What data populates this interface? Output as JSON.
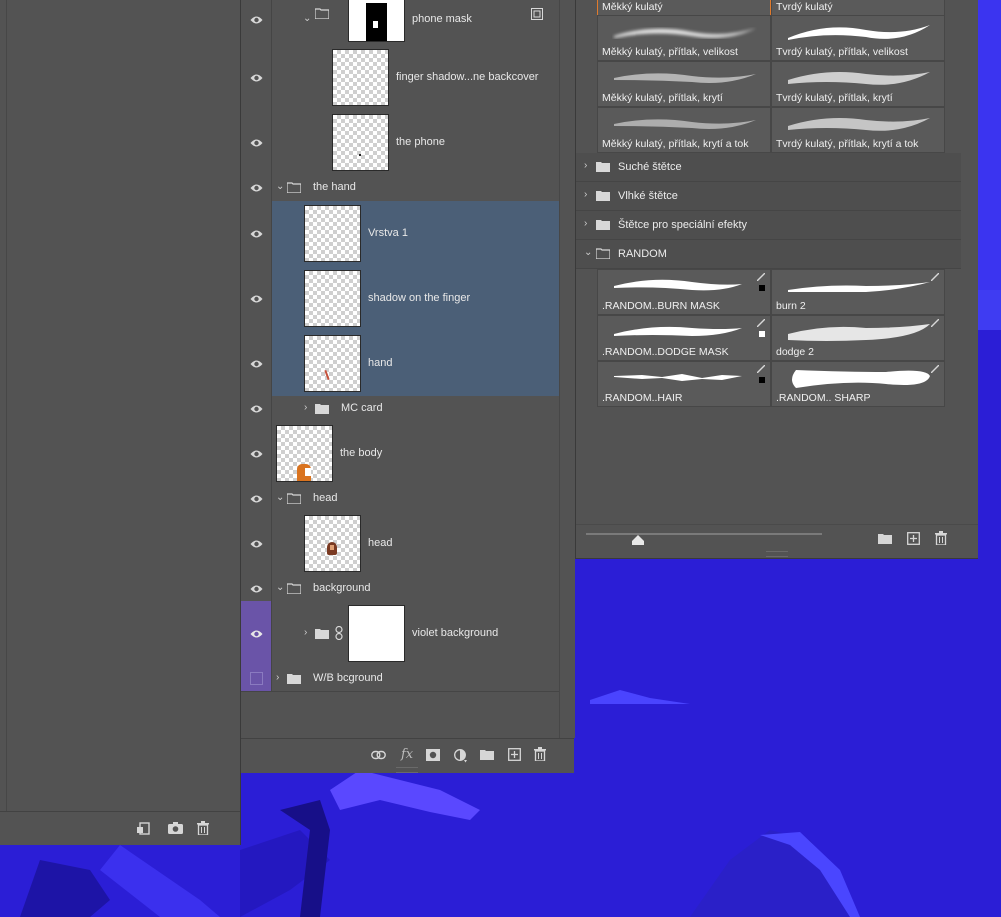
{
  "history_panel": {
    "footer_icons": [
      "new-document-from-state-icon",
      "snapshot-camera-icon",
      "trash-icon"
    ]
  },
  "layers": {
    "rows": [
      {
        "label": "phone mask",
        "type": "group-layer"
      },
      {
        "label": "finger shadow...ne backcover"
      },
      {
        "label": "the phone"
      },
      {
        "label": "the hand",
        "type": "group"
      },
      {
        "label": "Vrstva 1"
      },
      {
        "label": "shadow on the finger"
      },
      {
        "label": "hand"
      },
      {
        "label": "MC card",
        "type": "group"
      },
      {
        "label": "the body"
      },
      {
        "label": "head",
        "type": "group"
      },
      {
        "label": "head"
      },
      {
        "label": "background",
        "type": "group"
      },
      {
        "label": "violet background"
      },
      {
        "label": "W/B bcground",
        "type": "group"
      }
    ],
    "footer_icons": [
      "link-icon",
      "fx-icon",
      "mask-icon",
      "adjustment-icon",
      "folder-icon",
      "new-layer-icon",
      "trash-icon"
    ],
    "fx_label": "fx"
  },
  "brushes": {
    "top_grid": [
      {
        "label": "Měkký kulatý",
        "active": true
      },
      {
        "label": "Tvrdý kulatý"
      },
      {
        "label": "Měkký kulatý, přítlak, velikost"
      },
      {
        "label": "Tvrdý kulatý, přítlak, velikost"
      },
      {
        "label": "Měkký kulatý, přítlak, krytí"
      },
      {
        "label": "Tvrdý kulatý, přítlak, krytí"
      },
      {
        "label": "Měkký kulatý, přítlak, krytí a tok"
      },
      {
        "label": "Tvrdý kulatý, přítlak, krytí a tok"
      }
    ],
    "groups": [
      {
        "label": "Suché štětce",
        "expanded": false
      },
      {
        "label": "Vlhké štětce",
        "expanded": false
      },
      {
        "label": "Štětce pro speciální efekty",
        "expanded": false
      },
      {
        "label": "RANDOM",
        "expanded": true
      }
    ],
    "random_grid": [
      {
        "label": ".RANDOM..BURN MASK"
      },
      {
        "label": "burn 2"
      },
      {
        "label": ".RANDOM..DODGE MASK"
      },
      {
        "label": "dodge 2"
      },
      {
        "label": ".RANDOM..HAIR"
      },
      {
        "label": ".RANDOM.. SHARP"
      }
    ],
    "footer_icons": [
      "folder-icon",
      "new-brush-icon",
      "trash-icon"
    ]
  },
  "colors": {
    "accent": "#e07a2c",
    "selection": "#4b5f77",
    "canvas": "#2a1ed0",
    "violet_tag": "#6a54a8"
  }
}
